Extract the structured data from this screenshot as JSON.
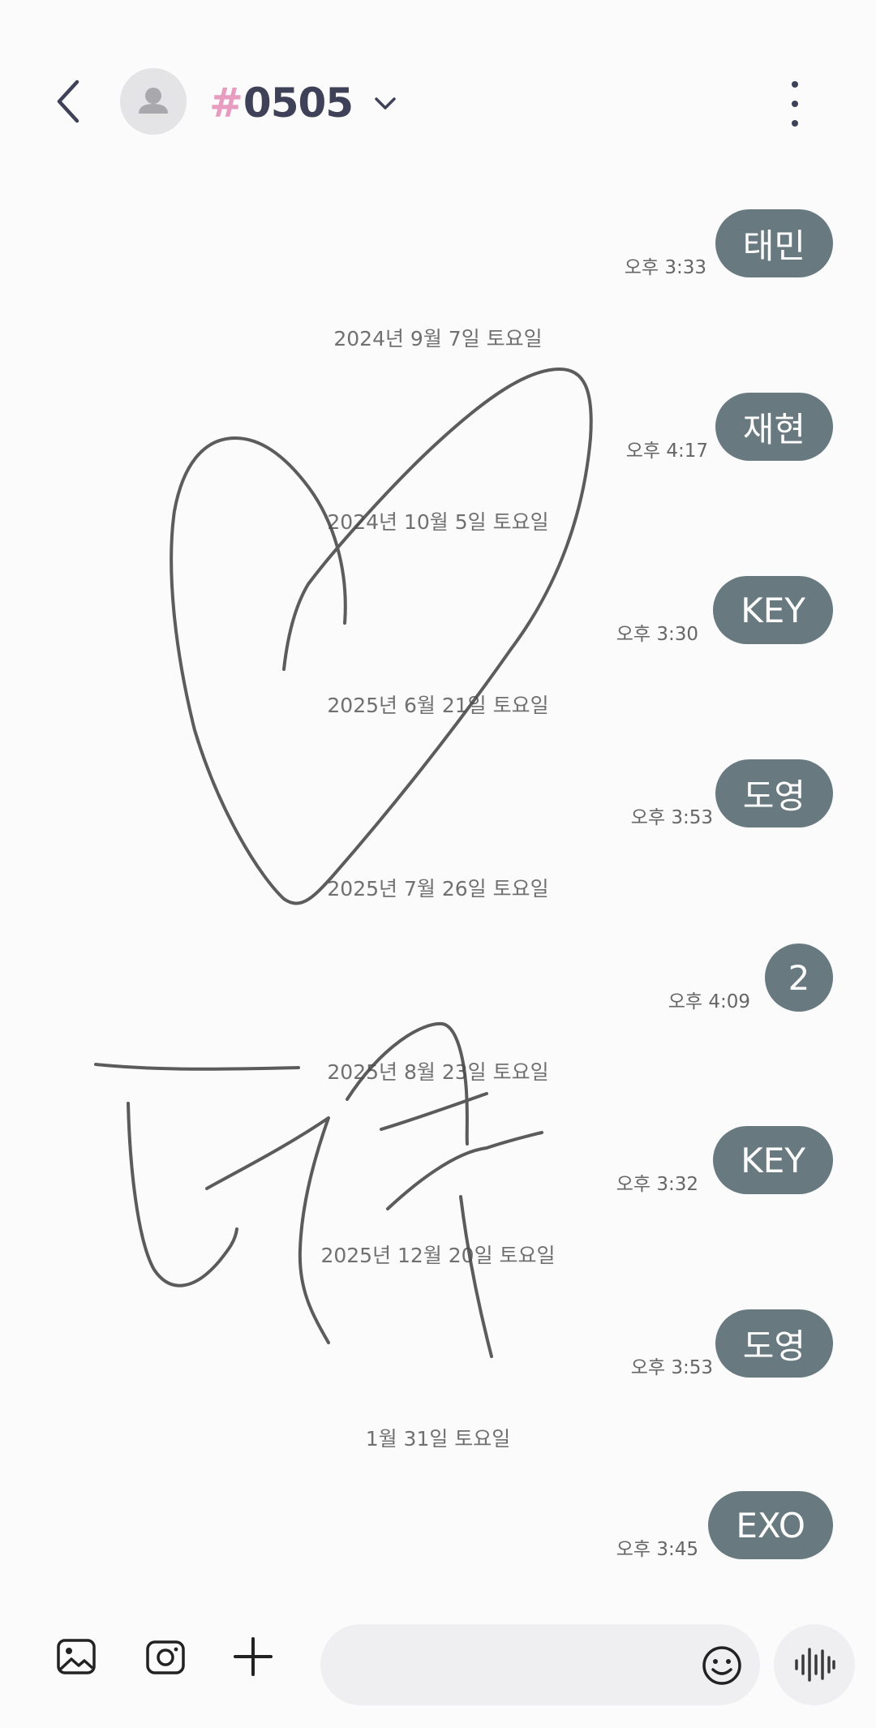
{
  "header": {
    "title_hash": "#",
    "title": "0505",
    "back_icon": "chevron-left-icon",
    "expand_icon": "chevron-down-icon",
    "more_icon": "more-vertical-icon"
  },
  "thread": [
    {
      "type": "message",
      "text": "태민",
      "time": "오후 3:33"
    },
    {
      "type": "date",
      "text": "2024년 9월 7일 토요일"
    },
    {
      "type": "message",
      "text": "재현",
      "time": "오후 4:17"
    },
    {
      "type": "date",
      "text": "2024년 10월 5일 토요일"
    },
    {
      "type": "message",
      "text": "KEY",
      "time": "오후 3:30"
    },
    {
      "type": "date",
      "text": "2025년 6월 21일 토요일"
    },
    {
      "type": "message",
      "text": "도영",
      "time": "오후 3:53"
    },
    {
      "type": "date",
      "text": "2025년 7월 26일 토요일"
    },
    {
      "type": "message",
      "text": "2",
      "time": "오후 4:09"
    },
    {
      "type": "date",
      "text": "2025년 8월 23일 토요일"
    },
    {
      "type": "message",
      "text": "KEY",
      "time": "오후 3:32"
    },
    {
      "type": "date",
      "text": "2025년 12월 20일 토요일"
    },
    {
      "type": "message",
      "text": "도영",
      "time": "오후 3:53"
    },
    {
      "type": "date",
      "text": "1월 31일 토요일"
    },
    {
      "type": "message",
      "text": "EXO",
      "time": "오후 3:45"
    }
  ],
  "composer": {
    "value": "",
    "gallery_icon": "image-icon",
    "camera_icon": "camera-icon",
    "attach_icon": "plus-icon",
    "emoji_icon": "smiley-icon",
    "voice_icon": "voice-wave-icon"
  },
  "colors": {
    "bubble": "#687a80",
    "title": "#3e4157",
    "hash": "#e79cc0",
    "background": "#fbfbfb"
  }
}
